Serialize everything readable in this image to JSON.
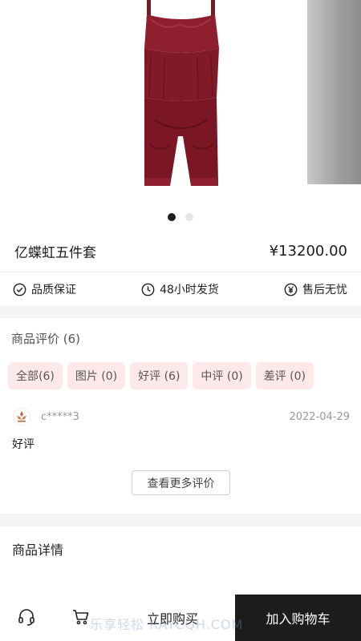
{
  "product": {
    "title": "亿蝶虹五件套",
    "price": "¥13200.00"
  },
  "gallery": {
    "slides": 2,
    "active": 1
  },
  "guarantees": [
    {
      "icon": "check-circle-icon",
      "label": "品质保证"
    },
    {
      "icon": "clock-icon",
      "label": "48小时发货"
    },
    {
      "icon": "yen-circle-icon",
      "label": "售后无忧"
    }
  ],
  "reviews": {
    "title": "商品评价 (6)",
    "tags": [
      "全部(6)",
      "图片 (0)",
      "好评 (6)",
      "中评 (0)",
      "差评 (0)"
    ],
    "item": {
      "user": "c*****3",
      "date": "2022-04-29",
      "text": "好评"
    },
    "more_label": "查看更多评价"
  },
  "details": {
    "title": "商品详情"
  },
  "bottom_bar": {
    "service_icon": "headset-icon",
    "cart_icon": "cart-icon",
    "buy_now": "立即购买",
    "add_to_cart": "加入购物车"
  },
  "watermark": "乐享轻松   RAYCQH.COM",
  "colors": {
    "tag_bg": "#fde9ea",
    "cart_button": "#1c1c1c",
    "product": "#8b1d2c"
  }
}
